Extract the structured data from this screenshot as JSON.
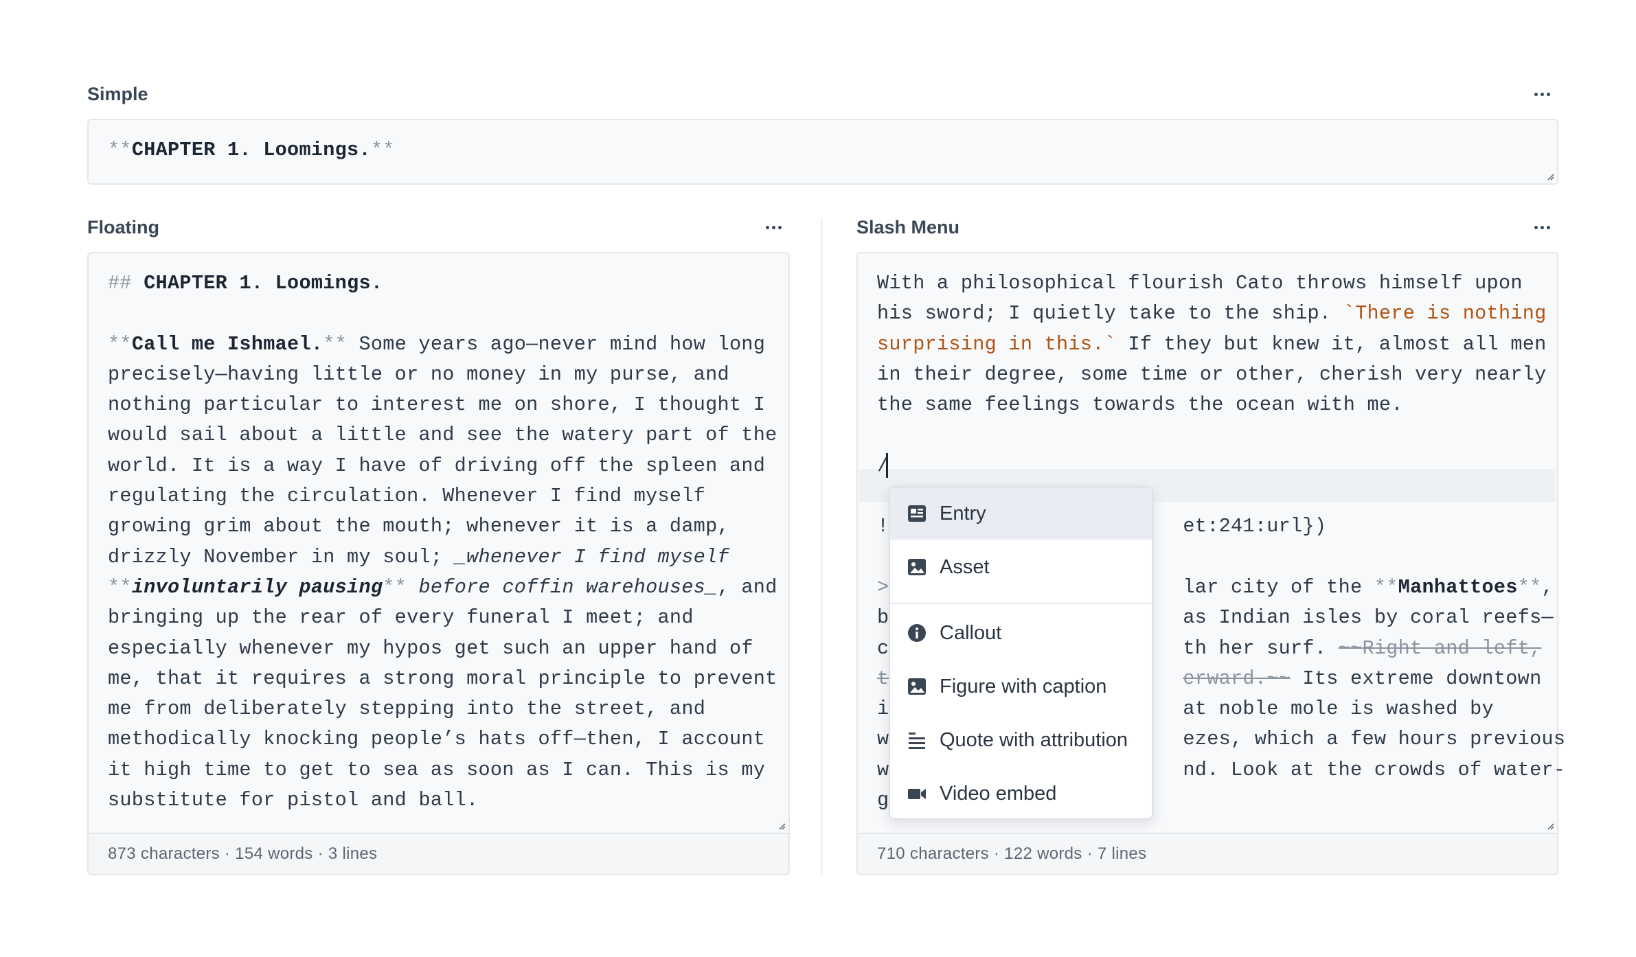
{
  "simple": {
    "label": "Simple",
    "content": {
      "pre": "**",
      "bold": "CHAPTER 1. Loomings.",
      "post": "**"
    }
  },
  "floating": {
    "label": "Floating",
    "lines": {
      "l1": {
        "mk": "## ",
        "b": "CHAPTER 1. Loomings."
      },
      "l3": {
        "mk1": "**",
        "b": "Call me Ishmael.",
        "mk2": "**",
        "rest": " Some years ago—never mind how long"
      },
      "l4": "precisely—having little or no money in my purse, and",
      "l5": "nothing particular to interest me on shore, I thought I",
      "l6": "would sail about a little and see the watery part of the",
      "l7": "world. It is a way I have of driving off the spleen and",
      "l8": "regulating the circulation. Whenever I find myself",
      "l9": "growing grim about the mouth; whenever it is a damp,",
      "l10": {
        "pre": "drizzly November in my soul; ",
        "it": "_whenever I find myself"
      },
      "l11": {
        "mk1": "**",
        "bi": "involuntarily pausing",
        "mk2": "**",
        "it": " before coffin warehouses_",
        "rest": ", and"
      },
      "l12": "bringing up the rear of every funeral I meet; and",
      "l13": "especially whenever my hypos get such an upper hand of",
      "l14": "me, that it requires a strong moral principle to prevent",
      "l15": "me from deliberately stepping into the street, and",
      "l16": "methodically knocking people’s hats off—then, I account",
      "l17": "it high time to get to sea as soon as I can. This is my",
      "l18": "substitute for pistol and ball."
    },
    "stats": "873 characters · 154 words · 3 lines"
  },
  "slash": {
    "label": "Slash Menu",
    "lines": {
      "l1": "With a philosophical flourish Cato throws himself upon",
      "l2": {
        "pre": "his sword; I quietly take to the ship. ",
        "code": "`There is nothing"
      },
      "l3": {
        "code": "surprising in this.`",
        "rest": " If they but knew it, almost all men"
      },
      "l4": "in their degree, some time or other, cherish very nearly",
      "l5": "the same feelings towards the ocean with me.",
      "l7": "/",
      "l9": {
        "a": "!",
        "b": "et:241:url})"
      },
      "l11": {
        "a": ">",
        "b": "lar city of the ",
        "mk1": "**",
        "bold": "Manhattoes",
        "mk2": "**",
        "c": ","
      },
      "l12": {
        "a": "b",
        "b": "as Indian isles by coral reefs—"
      },
      "l13": {
        "a": "c",
        "b": "th her surf. ",
        "s": "~~Right and left,"
      },
      "l14": {
        "a": "t",
        "s": "erward.~~",
        "b": " Its extreme downtown"
      },
      "l15": {
        "a": "i",
        "b": "at noble mole is washed by"
      },
      "l16": {
        "a": "w",
        "b": "ezes, which a few hours previous"
      },
      "l17": {
        "a": "w",
        "b": "nd. Look at the crowds of water-"
      },
      "l18": {
        "a": "g"
      }
    },
    "stats": "710 characters · 122 words · 7 lines",
    "menu": {
      "items": [
        {
          "label": "Entry",
          "icon": "entry-icon"
        },
        {
          "label": "Asset",
          "icon": "image-icon"
        },
        {
          "label": "Callout",
          "icon": "info-icon"
        },
        {
          "label": "Figure with caption",
          "icon": "image-icon"
        },
        {
          "label": "Quote with attribution",
          "icon": "text-align-icon"
        },
        {
          "label": "Video embed",
          "icon": "video-camera-icon"
        }
      ]
    }
  },
  "colors": {
    "accent_code": "#b25413",
    "active_item": "#e9edf3"
  }
}
